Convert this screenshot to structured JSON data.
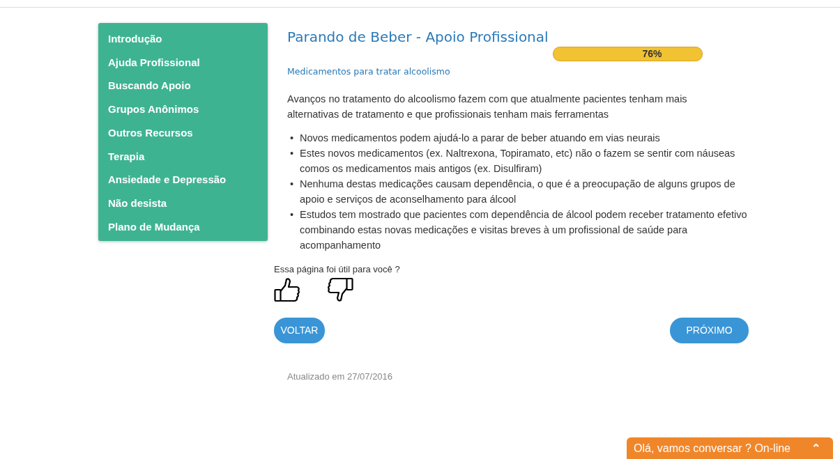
{
  "sidebar": {
    "items": [
      {
        "label": "Introdução"
      },
      {
        "label": "Ajuda Profissional"
      },
      {
        "label": "Buscando Apoio"
      },
      {
        "label": "Grupos Anônimos"
      },
      {
        "label": "Outros Recursos"
      },
      {
        "label": "Terapia"
      },
      {
        "label": "Ansiedade e Depressão"
      },
      {
        "label": "Não desista"
      },
      {
        "label": "Plano de Mudança"
      }
    ]
  },
  "title": "Parando de Beber - Apoio Profissional",
  "progress": {
    "reading": "76%"
  },
  "subtitle": "Medicamentos para tratar alcoolismo",
  "intro": "Avanços no tratamento do alcoolismo fazem com que atualmente pacientes tenham mais alternativas de tratamento e que profissionais tenham mais ferramentas",
  "bullet_marker": "•",
  "bullets": [
    "Novos medicamentos podem ajudá-lo a parar de beber atuando em vias neurais",
    "Estes novos medicamentos (ex. Naltrexona, Topiramato, etc) não o fazem se sentir com náuseas comos os medicamentos mais antigos (ex. Disulfiram)",
    "Nenhuma destas medicações causam dependência, o que é a preocupação de alguns grupos de apoio e serviços de aconselhamento para álcool",
    "Estudos tem mostrado que pacientes com dependência de álcool podem receber tratamento efetivo combinando estas novas medicações e visitas breves à um profissional de saúde para acompanhamento"
  ],
  "feedback": {
    "question": "Essa página foi útil para você ?"
  },
  "buttons": {
    "back": "VOLTAR",
    "next": "PRÓXIMO"
  },
  "updated": "Atualizado em 27/07/2016",
  "chat": {
    "label": "Olá, vamos conversar ? On-line",
    "expand_icon": "⌃"
  }
}
